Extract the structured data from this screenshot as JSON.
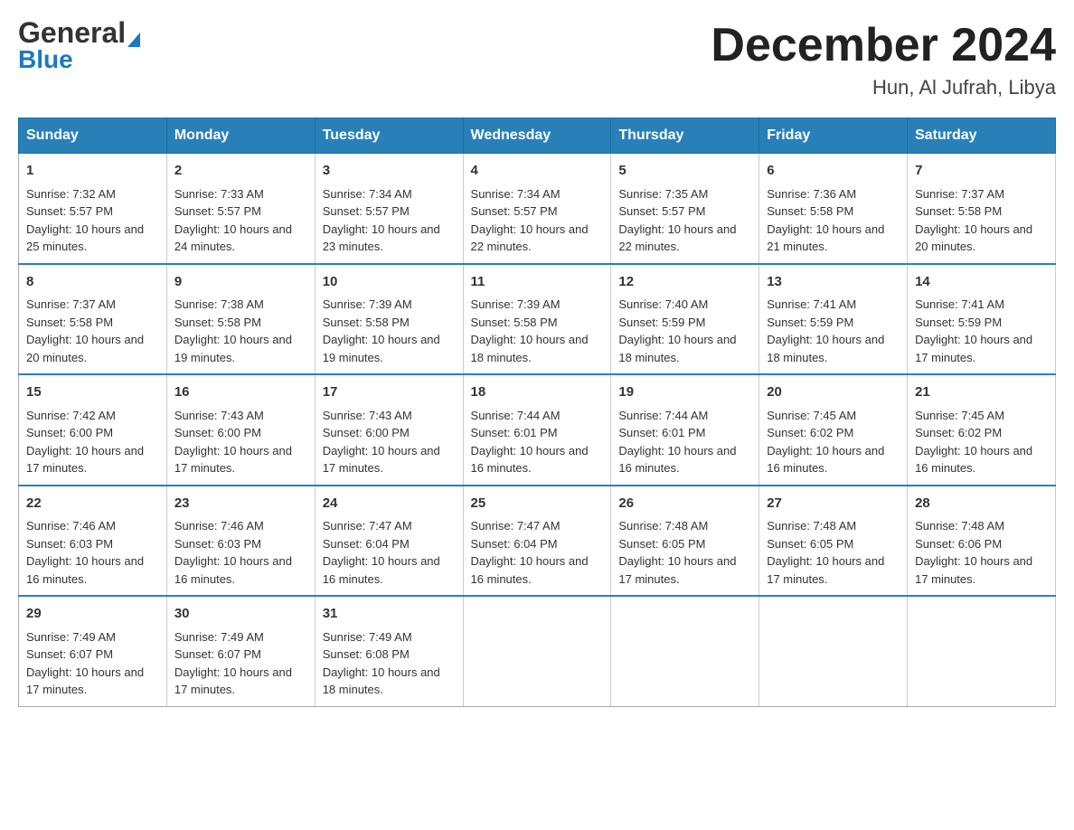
{
  "header": {
    "month_title": "December 2024",
    "location": "Hun, Al Jufrah, Libya",
    "logo_general": "General",
    "logo_blue": "Blue"
  },
  "days_of_week": [
    "Sunday",
    "Monday",
    "Tuesday",
    "Wednesday",
    "Thursday",
    "Friday",
    "Saturday"
  ],
  "weeks": [
    [
      {
        "day": "1",
        "sunrise": "7:32 AM",
        "sunset": "5:57 PM",
        "daylight": "10 hours and 25 minutes."
      },
      {
        "day": "2",
        "sunrise": "7:33 AM",
        "sunset": "5:57 PM",
        "daylight": "10 hours and 24 minutes."
      },
      {
        "day": "3",
        "sunrise": "7:34 AM",
        "sunset": "5:57 PM",
        "daylight": "10 hours and 23 minutes."
      },
      {
        "day": "4",
        "sunrise": "7:34 AM",
        "sunset": "5:57 PM",
        "daylight": "10 hours and 22 minutes."
      },
      {
        "day": "5",
        "sunrise": "7:35 AM",
        "sunset": "5:57 PM",
        "daylight": "10 hours and 22 minutes."
      },
      {
        "day": "6",
        "sunrise": "7:36 AM",
        "sunset": "5:58 PM",
        "daylight": "10 hours and 21 minutes."
      },
      {
        "day": "7",
        "sunrise": "7:37 AM",
        "sunset": "5:58 PM",
        "daylight": "10 hours and 20 minutes."
      }
    ],
    [
      {
        "day": "8",
        "sunrise": "7:37 AM",
        "sunset": "5:58 PM",
        "daylight": "10 hours and 20 minutes."
      },
      {
        "day": "9",
        "sunrise": "7:38 AM",
        "sunset": "5:58 PM",
        "daylight": "10 hours and 19 minutes."
      },
      {
        "day": "10",
        "sunrise": "7:39 AM",
        "sunset": "5:58 PM",
        "daylight": "10 hours and 19 minutes."
      },
      {
        "day": "11",
        "sunrise": "7:39 AM",
        "sunset": "5:58 PM",
        "daylight": "10 hours and 18 minutes."
      },
      {
        "day": "12",
        "sunrise": "7:40 AM",
        "sunset": "5:59 PM",
        "daylight": "10 hours and 18 minutes."
      },
      {
        "day": "13",
        "sunrise": "7:41 AM",
        "sunset": "5:59 PM",
        "daylight": "10 hours and 18 minutes."
      },
      {
        "day": "14",
        "sunrise": "7:41 AM",
        "sunset": "5:59 PM",
        "daylight": "10 hours and 17 minutes."
      }
    ],
    [
      {
        "day": "15",
        "sunrise": "7:42 AM",
        "sunset": "6:00 PM",
        "daylight": "10 hours and 17 minutes."
      },
      {
        "day": "16",
        "sunrise": "7:43 AM",
        "sunset": "6:00 PM",
        "daylight": "10 hours and 17 minutes."
      },
      {
        "day": "17",
        "sunrise": "7:43 AM",
        "sunset": "6:00 PM",
        "daylight": "10 hours and 17 minutes."
      },
      {
        "day": "18",
        "sunrise": "7:44 AM",
        "sunset": "6:01 PM",
        "daylight": "10 hours and 16 minutes."
      },
      {
        "day": "19",
        "sunrise": "7:44 AM",
        "sunset": "6:01 PM",
        "daylight": "10 hours and 16 minutes."
      },
      {
        "day": "20",
        "sunrise": "7:45 AM",
        "sunset": "6:02 PM",
        "daylight": "10 hours and 16 minutes."
      },
      {
        "day": "21",
        "sunrise": "7:45 AM",
        "sunset": "6:02 PM",
        "daylight": "10 hours and 16 minutes."
      }
    ],
    [
      {
        "day": "22",
        "sunrise": "7:46 AM",
        "sunset": "6:03 PM",
        "daylight": "10 hours and 16 minutes."
      },
      {
        "day": "23",
        "sunrise": "7:46 AM",
        "sunset": "6:03 PM",
        "daylight": "10 hours and 16 minutes."
      },
      {
        "day": "24",
        "sunrise": "7:47 AM",
        "sunset": "6:04 PM",
        "daylight": "10 hours and 16 minutes."
      },
      {
        "day": "25",
        "sunrise": "7:47 AM",
        "sunset": "6:04 PM",
        "daylight": "10 hours and 16 minutes."
      },
      {
        "day": "26",
        "sunrise": "7:48 AM",
        "sunset": "6:05 PM",
        "daylight": "10 hours and 17 minutes."
      },
      {
        "day": "27",
        "sunrise": "7:48 AM",
        "sunset": "6:05 PM",
        "daylight": "10 hours and 17 minutes."
      },
      {
        "day": "28",
        "sunrise": "7:48 AM",
        "sunset": "6:06 PM",
        "daylight": "10 hours and 17 minutes."
      }
    ],
    [
      {
        "day": "29",
        "sunrise": "7:49 AM",
        "sunset": "6:07 PM",
        "daylight": "10 hours and 17 minutes."
      },
      {
        "day": "30",
        "sunrise": "7:49 AM",
        "sunset": "6:07 PM",
        "daylight": "10 hours and 17 minutes."
      },
      {
        "day": "31",
        "sunrise": "7:49 AM",
        "sunset": "6:08 PM",
        "daylight": "10 hours and 18 minutes."
      },
      null,
      null,
      null,
      null
    ]
  ],
  "labels": {
    "sunrise": "Sunrise:",
    "sunset": "Sunset:",
    "daylight": "Daylight:"
  }
}
